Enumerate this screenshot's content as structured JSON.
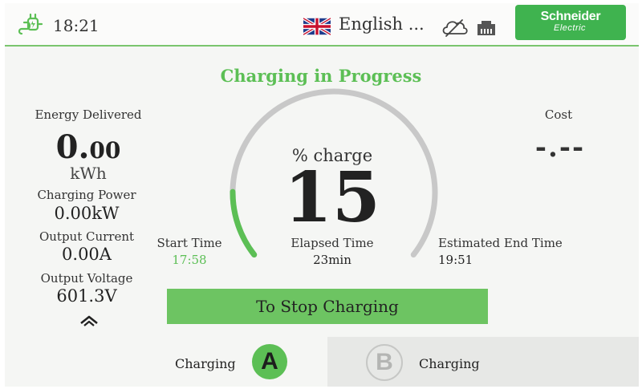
{
  "topbar": {
    "time": "18:21",
    "language": "English ...",
    "brand_name": "Schneider",
    "brand_sub": "Electric"
  },
  "session": {
    "status_title": "Charging in Progress",
    "energy_label": "Energy Delivered",
    "energy_int": "0.",
    "energy_dec": "00",
    "energy_unit": "kWh",
    "power_label": "Charging Power",
    "power_value": "0.00kW",
    "current_label": "Output Current",
    "current_value": "0.00A",
    "voltage_label": "Output Voltage",
    "voltage_value": "601.3V",
    "cost_label": "Cost",
    "cost_value": "-.--",
    "charge_label": "% charge",
    "charge_percent": "15",
    "charge_fraction": 0.15,
    "start_label": "Start Time",
    "start_value": "17:58",
    "elapsed_label": "Elapsed Time",
    "elapsed_value": "23min",
    "end_label": "Estimated End Time",
    "end_value": "19:51",
    "stop_button": "To Stop Charging"
  },
  "connectors": [
    {
      "letter": "A",
      "status": "Charging",
      "active": true
    },
    {
      "letter": "B",
      "status": "Charging",
      "active": false
    }
  ],
  "colors": {
    "accent": "#5cbf55",
    "brand": "#3fb34f",
    "gauge_track": "#c8c8c8"
  },
  "icons": {
    "plug": "ev-plug-icon",
    "flag": "uk-flag-icon",
    "cloud": "cloud-icon",
    "ethernet": "ethernet-icon",
    "expand": "chevron-up-icon"
  }
}
